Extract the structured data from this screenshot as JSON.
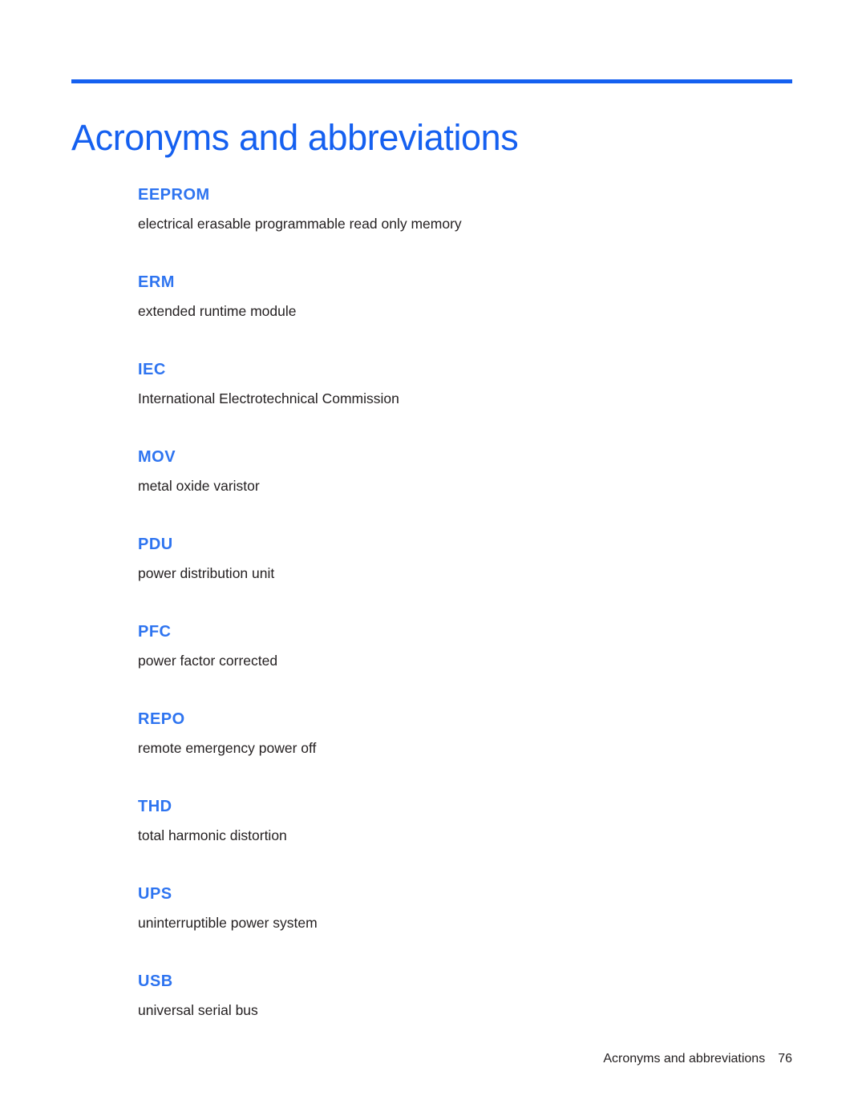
{
  "document": {
    "title": "Acronyms and abbreviations",
    "accent_color": "#1560f0",
    "term_color": "#2e74f0",
    "body_color": "#231f20"
  },
  "glossary": {
    "entries": [
      {
        "term": "EEPROM",
        "definition": "electrical erasable programmable read only memory"
      },
      {
        "term": "ERM",
        "definition": "extended runtime module"
      },
      {
        "term": "IEC",
        "definition": "International Electrotechnical Commission"
      },
      {
        "term": "MOV",
        "definition": "metal oxide varistor"
      },
      {
        "term": "PDU",
        "definition": "power distribution unit"
      },
      {
        "term": "PFC",
        "definition": "power factor corrected"
      },
      {
        "term": "REPO",
        "definition": "remote emergency power off"
      },
      {
        "term": "THD",
        "definition": "total harmonic distortion"
      },
      {
        "term": "UPS",
        "definition": "uninterruptible power system"
      },
      {
        "term": "USB",
        "definition": "universal serial bus"
      }
    ]
  },
  "footer": {
    "section_title": "Acronyms and abbreviations",
    "page_number": "76"
  }
}
